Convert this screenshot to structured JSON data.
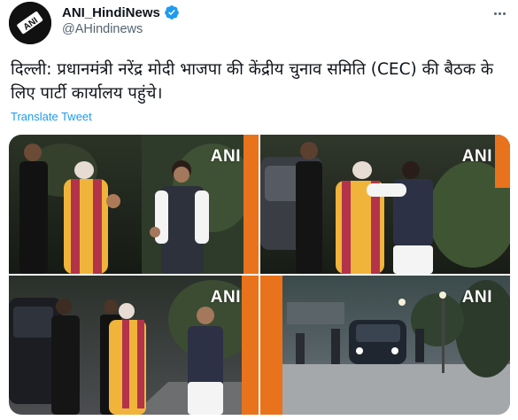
{
  "account": {
    "display_name": "ANI_HindiNews",
    "handle": "@AHindinews",
    "avatar_icon": "ani-logo-avatar",
    "verified_icon": "verified-badge-icon",
    "verified_color": "#1d9bf0"
  },
  "more_icon": "more-options-icon",
  "tweet": {
    "text": "दिल्ली: प्रधानमंत्री नरेंद्र मोदी भाजपा की केंद्रीय चुनाव समिति (CEC) की बैठक के लिए पार्टी कार्यालय पहुंचे।",
    "translate_label": "Translate Tweet"
  },
  "media": {
    "watermark": "ANI",
    "images": [
      {
        "name": "photo-1"
      },
      {
        "name": "photo-2"
      },
      {
        "name": "photo-3"
      },
      {
        "name": "photo-4"
      }
    ]
  },
  "colors": {
    "text_primary": "#0f1419",
    "text_secondary": "#536471",
    "link": "#1d9bf0"
  }
}
